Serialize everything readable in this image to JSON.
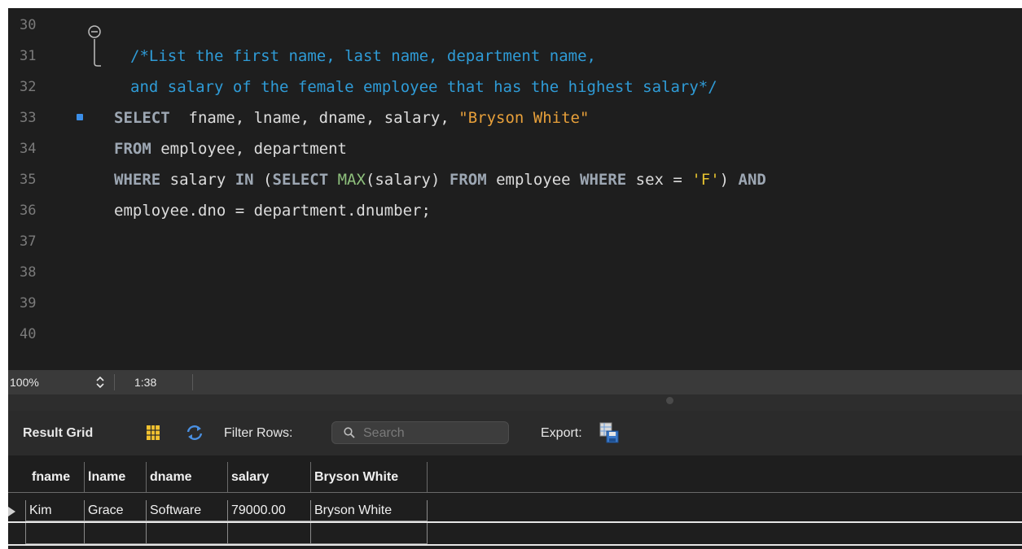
{
  "editor": {
    "line_numbers": [
      "30",
      "31",
      "32",
      "33",
      "34",
      "35",
      "36",
      "37",
      "38",
      "39",
      "40"
    ],
    "comment_line_1": "/*List the first name, last name, department name,",
    "comment_line_2": "and salary of the female employee that has the highest salary*/",
    "line33": {
      "kw_select": "SELECT",
      "cols": "  fname, lname, dname, salary, ",
      "literal": "\"Bryson White\""
    },
    "line34": {
      "kw_from": "FROM",
      "rest": " employee, department"
    },
    "line35": {
      "kw_where": "WHERE",
      "p1": " salary ",
      "kw_in": "IN",
      "p2": " (",
      "kw_select": "SELECT",
      "p3": " ",
      "fn_max": "MAX",
      "p4": "(salary) ",
      "kw_from": "FROM",
      "p5": " employee ",
      "kw_where2": "WHERE",
      "p6": " sex = ",
      "literal": "'F'",
      "p7": ") ",
      "kw_and": "AND"
    },
    "line36": {
      "rest": "employee.dno = department.dnumber;"
    }
  },
  "status_bar": {
    "zoom": "100%",
    "cursor_position": "1:38"
  },
  "result_toolbar": {
    "title": "Result Grid",
    "filter_label": "Filter Rows:",
    "search_placeholder": "Search",
    "export_label": "Export:"
  },
  "result_grid": {
    "columns": [
      "fname",
      "lname",
      "dname",
      "salary",
      "Bryson White"
    ],
    "rows": [
      [
        "Kim",
        "Grace",
        "Software",
        "79000.00",
        "Bryson White"
      ]
    ]
  },
  "colors": {
    "editor_bg": "#1e1e1e",
    "comment": "#2f9bd6",
    "keyword": "#9da7b3",
    "function": "#8ec07c",
    "string_double": "#e8a03a",
    "string_single": "#e5c22f",
    "bookmark": "#3b8ee8"
  },
  "icons": [
    "fold-icon",
    "bookmark-icon",
    "stepper-icon",
    "grid-icon",
    "refresh-icon",
    "search-icon",
    "export-icon",
    "row-pointer-icon"
  ]
}
